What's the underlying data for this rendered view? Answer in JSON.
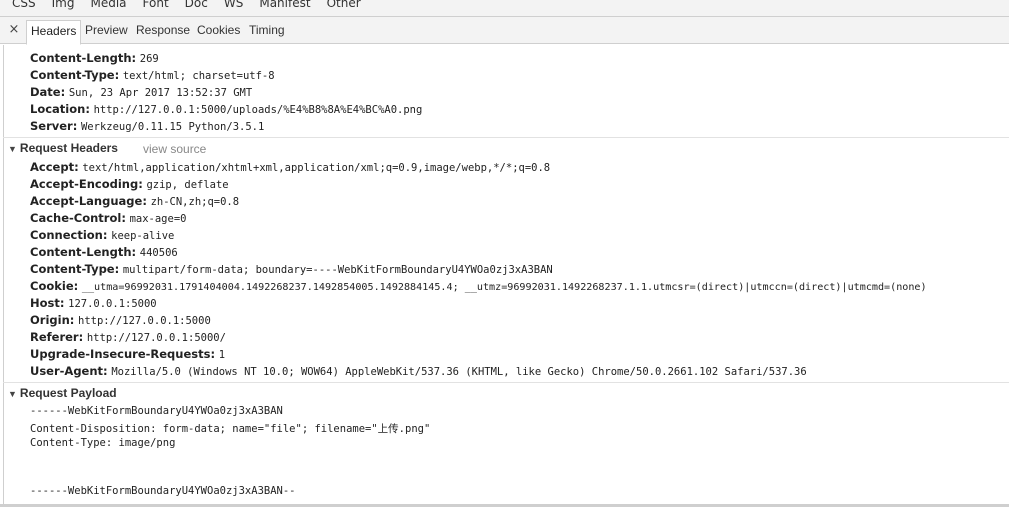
{
  "filters": [
    "CSS",
    "Img",
    "Media",
    "Font",
    "Doc",
    "WS",
    "Manifest",
    "Other"
  ],
  "tabs": {
    "close": "×",
    "items": [
      "Headers",
      "Preview",
      "Response",
      "Cookies",
      "Timing"
    ]
  },
  "response_headers": [
    {
      "name": "Content-Length:",
      "value": "269"
    },
    {
      "name": "Content-Type:",
      "value": "text/html; charset=utf-8"
    },
    {
      "name": "Date:",
      "value": "Sun, 23 Apr 2017 13:52:37 GMT"
    },
    {
      "name": "Location:",
      "value": "http://127.0.0.1:5000/uploads/%E4%B8%8A%E4%BC%A0.png"
    },
    {
      "name": "Server:",
      "value": "Werkzeug/0.11.15 Python/3.5.1"
    }
  ],
  "request_headers": {
    "title": "Request Headers",
    "view_source": "view source",
    "items": [
      {
        "name": "Accept:",
        "value": "text/html,application/xhtml+xml,application/xml;q=0.9,image/webp,*/*;q=0.8"
      },
      {
        "name": "Accept-Encoding:",
        "value": "gzip, deflate"
      },
      {
        "name": "Accept-Language:",
        "value": "zh-CN,zh;q=0.8"
      },
      {
        "name": "Cache-Control:",
        "value": "max-age=0"
      },
      {
        "name": "Connection:",
        "value": "keep-alive"
      },
      {
        "name": "Content-Length:",
        "value": "440506"
      },
      {
        "name": "Content-Type:",
        "value": "multipart/form-data; boundary=----WebKitFormBoundaryU4YWOa0zj3xA3BAN"
      },
      {
        "name": "Cookie:",
        "value": "__utma=96992031.1791404004.1492268237.1492854005.1492884145.4; __utmz=96992031.1492268237.1.1.utmcsr=(direct)|utmccn=(direct)|utmcmd=(none)"
      },
      {
        "name": "Host:",
        "value": "127.0.0.1:5000"
      },
      {
        "name": "Origin:",
        "value": "http://127.0.0.1:5000"
      },
      {
        "name": "Referer:",
        "value": "http://127.0.0.1:5000/"
      },
      {
        "name": "Upgrade-Insecure-Requests:",
        "value": "1"
      },
      {
        "name": "User-Agent:",
        "value": "Mozilla/5.0 (Windows NT 10.0; WOW64) AppleWebKit/537.36 (KHTML, like Gecko) Chrome/50.0.2661.102 Safari/537.36"
      }
    ]
  },
  "request_payload": {
    "title": "Request Payload",
    "lines": [
      "------WebKitFormBoundaryU4YWOa0zj3xA3BAN",
      "Content-Disposition: form-data; name=\"file\"; filename=\"上传.png\"",
      "Content-Type: image/png",
      "",
      "",
      "------WebKitFormBoundaryU4YWOa0zj3xA3BAN--"
    ]
  }
}
